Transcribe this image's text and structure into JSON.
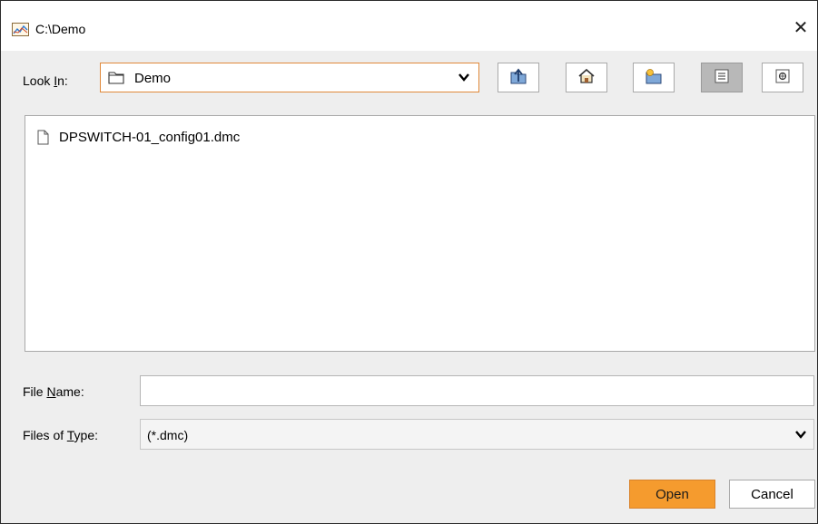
{
  "window": {
    "title": "C:\\Demo",
    "close_glyph": "✕"
  },
  "look_in": {
    "label_pre": "Look ",
    "label_mnemonic": "I",
    "label_post": "n:",
    "value": "Demo"
  },
  "toolbar": {
    "buttons": [
      {
        "name": "up-one-level",
        "icon": "folder-up-icon"
      },
      {
        "name": "home",
        "icon": "home-icon"
      },
      {
        "name": "new-folder",
        "icon": "new-folder-icon"
      },
      {
        "name": "list-view",
        "icon": "list-view-icon",
        "pressed": true
      },
      {
        "name": "details-view",
        "icon": "details-view-icon"
      }
    ]
  },
  "files": [
    {
      "name": "DPSWITCH-01_config01.dmc"
    }
  ],
  "file_name": {
    "label_pre": "File ",
    "label_mnemonic": "N",
    "label_post": "ame:",
    "value": ""
  },
  "files_of_type": {
    "label_pre": "Files of ",
    "label_mnemonic": "T",
    "label_post": "ype:",
    "value": "(*.dmc)"
  },
  "actions": {
    "open_label": "Open",
    "cancel_label": "Cancel"
  },
  "colors": {
    "accent": "#f59b2e",
    "focus_border": "#e0893a",
    "panel_bg": "#eeeeee"
  }
}
